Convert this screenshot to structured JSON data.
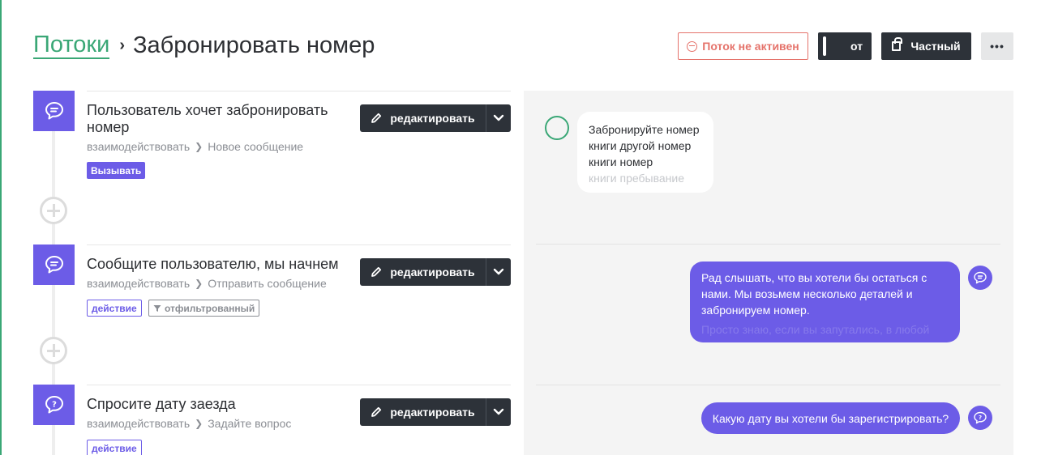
{
  "breadcrumb": {
    "parent": "Потоки",
    "title": "Забронировать номер"
  },
  "header": {
    "inactive_label": "Поток не активен",
    "toggle_label": "от",
    "private_label": "Частный",
    "more_label": "•••"
  },
  "steps": [
    {
      "title": "Пользователь хочет забронировать номер",
      "type": "взаимодействовать",
      "subtype": "Новое сообщение",
      "tags": [
        "Вызывать"
      ],
      "icon": "chat-bubble-icon",
      "edit_label": "редактировать"
    },
    {
      "title": "Сообщите пользователю, мы начнем",
      "type": "взаимодействовать",
      "subtype": "Отправить сообщение",
      "tags": [
        "действие",
        "отфильтрованный"
      ],
      "icon": "chat-bubble-icon",
      "edit_label": "редактировать"
    },
    {
      "title": "Спросите дату заезда",
      "type": "взаимодействовать",
      "subtype": "Задайте вопрос",
      "tags": [
        "действие"
      ],
      "icon": "question-bubble-icon",
      "edit_label": "редактировать"
    }
  ],
  "preview": {
    "user_lines": [
      "Забронируйте номер",
      "книги другой номер",
      "книги номер",
      "книги пребывание"
    ],
    "bot_message_1": {
      "lines": [
        "Рад слышать, что вы хотели бы остаться с",
        "нами. Мы возьмем несколько деталей и",
        "забронируем номер."
      ],
      "faded": "Просто знаю, если вы запутались, в любой"
    },
    "bot_message_2": "Какую дату вы хотели бы зарегистрировать?"
  },
  "colors": {
    "accent_green": "#3aa776",
    "accent_purple": "#6c5ce7",
    "dark_button": "#2d3239",
    "inactive_red": "#e5736b"
  }
}
